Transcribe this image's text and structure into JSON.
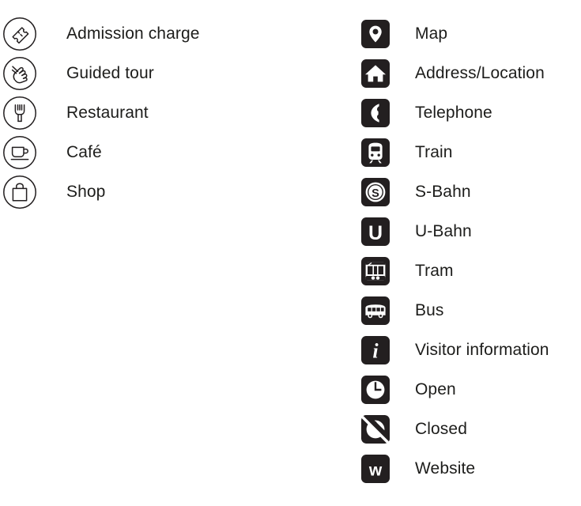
{
  "legend": {
    "outline_column": {
      "items": [
        {
          "icon": "ticket-icon",
          "label": "Admission charge"
        },
        {
          "icon": "pointing-hand-icon",
          "label": "Guided tour"
        },
        {
          "icon": "fork-icon",
          "label": "Restaurant"
        },
        {
          "icon": "coffee-cup-icon",
          "label": "Café"
        },
        {
          "icon": "shopping-bag-icon",
          "label": "Shop"
        }
      ]
    },
    "solid_column": {
      "items": [
        {
          "icon": "map-pin-icon",
          "label": "Map"
        },
        {
          "icon": "house-icon",
          "label": "Address/Location"
        },
        {
          "icon": "telephone-icon",
          "label": "Telephone"
        },
        {
          "icon": "train-icon",
          "label": "Train"
        },
        {
          "icon": "s-bahn-icon",
          "label": "S-Bahn"
        },
        {
          "icon": "u-bahn-icon",
          "label": "U-Bahn"
        },
        {
          "icon": "tram-icon",
          "label": "Tram"
        },
        {
          "icon": "bus-icon",
          "label": "Bus"
        },
        {
          "icon": "info-icon",
          "label": "Visitor information"
        },
        {
          "icon": "clock-open-icon",
          "label": "Open"
        },
        {
          "icon": "clock-closed-icon",
          "label": "Closed"
        },
        {
          "icon": "website-w-icon",
          "label": "Website"
        }
      ]
    },
    "colors": {
      "icon_solid_background": "#231f20",
      "icon_glyph": "#ffffff",
      "icon_outline_stroke": "#231f20",
      "text": "#1d1d1b",
      "page_background": "#ffffff"
    }
  }
}
